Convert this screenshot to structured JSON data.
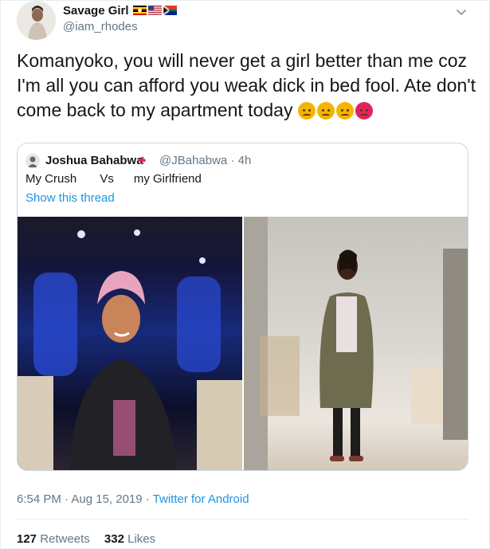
{
  "author": {
    "display_name": "Savage Girl",
    "handle": "@iam_rhodes",
    "flags": [
      "uganda-flag",
      "usa-flag",
      "south-africa-flag"
    ]
  },
  "tweet": {
    "text": "Komanyoko, you will never get a girl better than me coz I'm all you can afford you weak dick in bed fool. Ate don't come back to my apartment today",
    "emojis": [
      "angry-face",
      "angry-face",
      "angry-face",
      "pouting-face"
    ]
  },
  "quoted_tweet": {
    "display_name": "Joshua Bahabwa",
    "flag": "canada-maple-leaf",
    "handle": "@JBahabwa · 4h",
    "text": "My Crush       Vs      my Girlfriend",
    "show_thread": "Show this thread",
    "photos": [
      "woman in pink headwrap and black dress",
      "woman in olive jacket and floral top"
    ]
  },
  "meta": {
    "time_date": "6:54 PM · Aug 15, 2019 · ",
    "source": "Twitter for Android"
  },
  "stats": {
    "retweets_count": "127",
    "retweets_label": "Retweets",
    "likes_count": "332",
    "likes_label": "Likes"
  },
  "colors": {
    "link": "#1b95e0",
    "secondary_text": "#657786",
    "border": "#ccd6dd"
  }
}
